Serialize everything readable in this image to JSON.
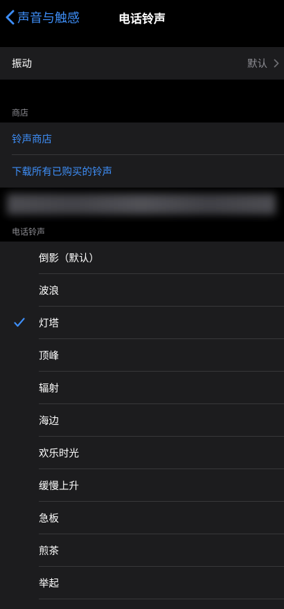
{
  "nav": {
    "back_label": "声音与触感",
    "title": "电话铃声"
  },
  "vibration": {
    "label": "振动",
    "value": "默认"
  },
  "store": {
    "header": "商店",
    "items": [
      {
        "label": "铃声商店"
      },
      {
        "label": "下载所有已购买的铃声"
      }
    ]
  },
  "ringtones": {
    "header": "电话铃声",
    "selected_index": 2,
    "items": [
      {
        "label": "倒影（默认）"
      },
      {
        "label": "波浪"
      },
      {
        "label": "灯塔"
      },
      {
        "label": "顶峰"
      },
      {
        "label": "辐射"
      },
      {
        "label": "海边"
      },
      {
        "label": "欢乐时光"
      },
      {
        "label": "缓慢上升"
      },
      {
        "label": "急板"
      },
      {
        "label": "煎茶"
      },
      {
        "label": "举起"
      }
    ]
  },
  "icons": {
    "back": "chevron-left-icon",
    "disclosure": "chevron-right-icon",
    "selected": "checkmark-icon"
  },
  "colors": {
    "accent": "#3e8ef7",
    "background": "#000000",
    "cell": "#1c1c1e",
    "secondary_text": "#8d8d93",
    "separator": "#38383a"
  }
}
